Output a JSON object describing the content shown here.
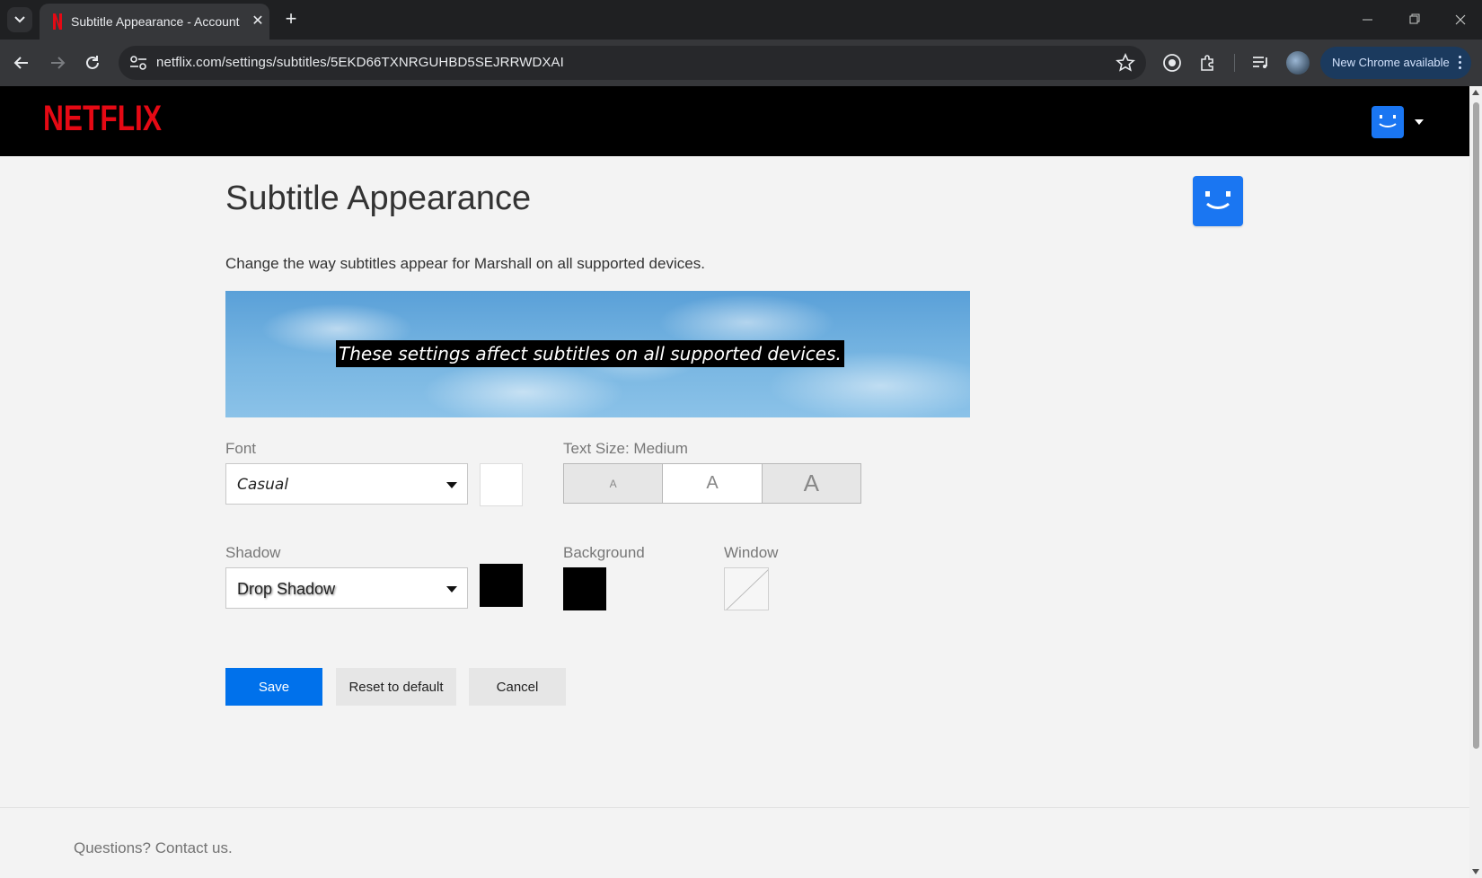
{
  "browser": {
    "tab_title": "Subtitle Appearance - Account",
    "url": "netflix.com/settings/subtitles/5EKD66TXNRGUHBD5SEJRRWDXAI",
    "update_label": "New Chrome available"
  },
  "header": {
    "logo_text": "NETFLIX"
  },
  "page": {
    "title": "Subtitle Appearance",
    "intro": "Change the way subtitles appear for Marshall on all supported devices.",
    "preview_text": "These settings affect subtitles on all supported devices."
  },
  "font": {
    "label": "Font",
    "value": "Casual",
    "color": "#ffffff"
  },
  "text_size": {
    "label": "Text Size: Medium",
    "options": [
      "A",
      "A",
      "A"
    ],
    "selected": "Medium"
  },
  "shadow": {
    "label": "Shadow",
    "value": "Drop Shadow",
    "color": "#000000"
  },
  "background": {
    "label": "Background",
    "color": "#000000"
  },
  "window": {
    "label": "Window",
    "color": "none"
  },
  "actions": {
    "save": "Save",
    "reset": "Reset to default",
    "cancel": "Cancel"
  },
  "footer": {
    "prefix": "Questions? ",
    "link": "Contact us."
  },
  "colors": {
    "netflix_red": "#e50914",
    "primary_blue": "#0071eb",
    "avatar_blue": "#1a76f2"
  },
  "icons": [
    "tab-search-icon",
    "netflix-favicon",
    "close-icon",
    "plus-icon",
    "minimize-icon",
    "restore-icon",
    "back-icon",
    "forward-icon",
    "reload-icon",
    "site-info-icon",
    "star-icon",
    "extension-icon",
    "puzzle-icon",
    "media-icon",
    "kebab-icon",
    "caret-down-icon"
  ]
}
